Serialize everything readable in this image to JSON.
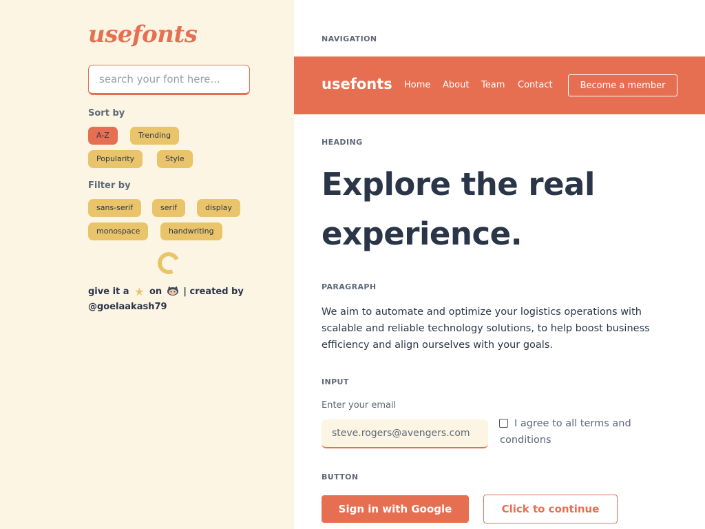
{
  "sidebar": {
    "logo": "usefonts",
    "search_placeholder": "search your font here...",
    "sort_label": "Sort by",
    "sort_options": [
      "A-Z",
      "Trending",
      "Popularity",
      "Style"
    ],
    "sort_active": "A-Z",
    "filter_label": "Filter by",
    "filter_options": [
      "sans-serif",
      "serif",
      "display",
      "monospace",
      "handwriting"
    ],
    "credits": {
      "prefix": "give it a",
      "star_icon": "star-icon",
      "middle": "on",
      "github_icon": "github-icon",
      "suffix": "| created by",
      "handle": "@goelaakash79"
    }
  },
  "sections": {
    "navigation": "NAVIGATION",
    "heading": "HEADING",
    "paragraph": "PARAGRAPH",
    "input": "INPUT",
    "button": "BUTTON"
  },
  "navbar": {
    "brand": "usefonts",
    "links": [
      "Home",
      "About",
      "Team",
      "Contact"
    ],
    "cta": "Become a member"
  },
  "heading": "Explore the real experience.",
  "paragraph": "We aim to automate and optimize your logistics operations with scalable and reliable technology solutions, to help boost business efficiency and align ourselves with your goals.",
  "input": {
    "caption": "Enter your email",
    "email_value": "steve.rogers@avengers.com",
    "terms": "I agree to all terms and conditions",
    "terms_checked": false
  },
  "buttons": {
    "primary": "Sign in with Google",
    "secondary": "Click to continue"
  },
  "colors": {
    "accent": "#e76f51",
    "chip": "#e9c46a",
    "sidebar_bg": "#fdf5e4",
    "text": "#2a3547"
  }
}
